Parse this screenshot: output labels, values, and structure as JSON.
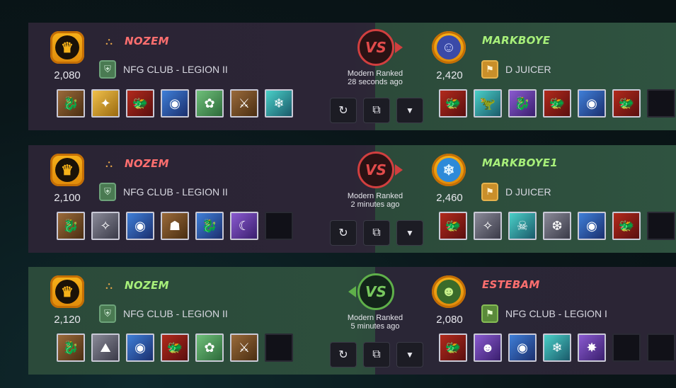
{
  "battles": [
    {
      "mode": "Modern Ranked",
      "time": "28 seconds ago",
      "left": {
        "name": "NOZEM",
        "rating": "2,080",
        "guild": "NFG CLUB - LEGION II",
        "cards": [
          "dragon",
          "healer",
          "red-dragon",
          "blue-eye",
          "green-mage",
          "barbarian",
          "ice-dragon"
        ]
      },
      "right": {
        "name": "MARKBOYE",
        "rating": "2,420",
        "guild": "D JUICER",
        "cards": [
          "red-dragon",
          "dinosaur",
          "purple-dragon",
          "red-dragon",
          "blue-eye",
          "red-dragon",
          "empty"
        ]
      }
    },
    {
      "mode": "Modern Ranked",
      "time": "2 minutes ago",
      "left": {
        "name": "NOZEM",
        "rating": "2,100",
        "guild": "NFG CLUB - LEGION II",
        "cards": [
          "dragon",
          "wizard",
          "blue-eye",
          "witch",
          "blue-dragon",
          "vampire",
          "empty"
        ]
      },
      "right": {
        "name": "MARKBOYE1",
        "rating": "2,460",
        "guild": "D JUICER",
        "cards": [
          "red-dragon",
          "wizard",
          "skeleton",
          "yeti",
          "blue-eye",
          "red-dragon",
          "empty"
        ]
      }
    },
    {
      "mode": "Modern Ranked",
      "time": "5 minutes ago",
      "left": {
        "name": "NOZEM",
        "rating": "2,120",
        "guild": "NFG CLUB - LEGION II",
        "cards": [
          "dragon",
          "golem",
          "blue-eye",
          "red-dragon",
          "green-mage",
          "barbarian",
          "empty"
        ]
      },
      "right": {
        "name": "ESTEBAM",
        "rating": "2,080",
        "guild": "NFG CLUB - LEGION I",
        "cards": [
          "red-dragon",
          "goblin",
          "blue-eye",
          "ice-dragon",
          "spider",
          "empty",
          "empty"
        ]
      }
    }
  ],
  "vs_label": "VS",
  "colors": {
    "loss": "#d13f3f",
    "win": "#5fb04a",
    "name_red": "#ff6f6f",
    "name_green": "#a8f07a"
  }
}
